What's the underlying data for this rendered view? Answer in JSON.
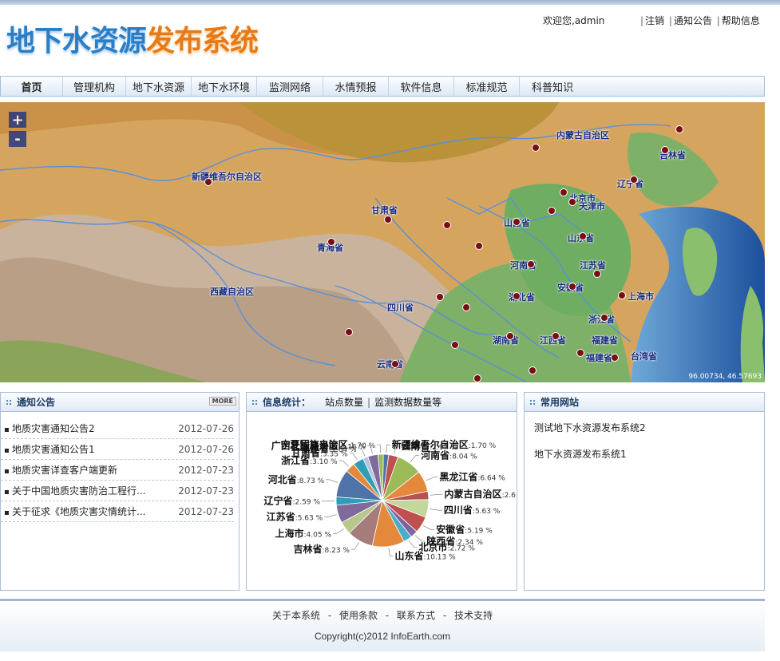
{
  "header": {
    "logo_part1": "地下水资源",
    "logo_part2": "发布系统",
    "welcome": "欢迎您,admin",
    "links": [
      "注销",
      "通知公告",
      "帮助信息"
    ]
  },
  "nav": {
    "items": [
      "首页",
      "管理机构",
      "地下水资源",
      "地下水环境",
      "监测网络",
      "水情预报",
      "软件信息",
      "标准规范",
      "科普知识"
    ],
    "active": "首页"
  },
  "map": {
    "zoom_in": "+",
    "zoom_out": "-",
    "coords": "96.00734, 46.57693",
    "labels": [
      "内蒙古自治区",
      "吉林省",
      "新疆维吾尔自治区",
      "辽宁省",
      "北京市",
      "天津市",
      "甘肃省",
      "山西省",
      "山东省",
      "青海省",
      "河南省",
      "江苏省",
      "西藏自治区",
      "四川省",
      "安徽省",
      "湖北省",
      "上海市",
      "浙江省",
      "湖南省",
      "江西省",
      "福建省",
      "台湾省",
      "云南省",
      "福建省"
    ]
  },
  "notice_panel": {
    "title": "通知公告",
    "more_label": "MORE",
    "items": [
      {
        "title": "地质灾害通知公告2",
        "date": "2012-07-26"
      },
      {
        "title": "地质灾害通知公告1",
        "date": "2012-07-26"
      },
      {
        "title": "地质灾害详查客户端更新",
        "date": "2012-07-23"
      },
      {
        "title": "关于中国地质灾害防治工程行...",
        "date": "2012-07-23"
      },
      {
        "title": "关于征求《地质灾害灾情统计...",
        "date": "2012-07-23"
      }
    ]
  },
  "stats_panel": {
    "title": "信息统计：",
    "tab1": "站点数量",
    "tab_sep": "|",
    "tab2": "监测数据数量等"
  },
  "sites_panel": {
    "title": "常用网站",
    "links": [
      "测试地下水资源发布系统2",
      "地下水资源发布系统1"
    ]
  },
  "chart_data": {
    "type": "pie",
    "slices": [
      {
        "label": "新疆维吾尔自治区",
        "value": 1.7,
        "color": "#4f72a8"
      },
      {
        "label": "云南省",
        "value": 2.97,
        "color": "#c0504d"
      },
      {
        "label": "河南省",
        "value": 8.04,
        "color": "#9bbb59"
      },
      {
        "label": "黑龙江省",
        "value": 6.64,
        "color": "#e4893b"
      },
      {
        "label": "内蒙古自治区",
        "value": 2.6,
        "display": "2.6",
        "color": "#b6524f"
      },
      {
        "label": "四川省",
        "value": 5.63,
        "color": "#c3d69b"
      },
      {
        "label": "安徽省",
        "value": 5.19,
        "color": "#c0504d"
      },
      {
        "label": "陕西省",
        "value": 2.34,
        "color": "#8064a2"
      },
      {
        "label": "北京市",
        "value": 2.72,
        "color": "#4bacc6"
      },
      {
        "label": "山东省",
        "value": 10.13,
        "color": "#e4893b"
      },
      {
        "label": "吉林省",
        "value": 8.23,
        "color": "#a67c7b"
      },
      {
        "label": "上海市",
        "value": 4.05,
        "color": "#b7c78d"
      },
      {
        "label": "江苏省",
        "value": 5.63,
        "color": "#7f6a9b"
      },
      {
        "label": "辽宁省",
        "value": 2.59,
        "color": "#2f9db5"
      },
      {
        "label": "河北省",
        "value": 8.73,
        "color": "#4f72a8"
      },
      {
        "label": "浙江省",
        "value": 3.1,
        "color": "#e4893b"
      },
      {
        "label": "甘肃省",
        "value": 3.35,
        "color": "#2f9db5"
      },
      {
        "label": "福建省",
        "value": 1.64,
        "color": "#b7c3dd"
      },
      {
        "label": "广西壮族自治区",
        "value": 3.16,
        "color": "#7f6a9b"
      },
      {
        "label": "宁夏回族自治区",
        "value": 1.7,
        "color": "#9bbb59"
      }
    ]
  },
  "footer": {
    "links": [
      "关于本系统",
      "使用条款",
      "联系方式",
      "技术支持"
    ],
    "separator": "-",
    "copyright": "Copyright(c)2012 InfoEarth.com"
  }
}
